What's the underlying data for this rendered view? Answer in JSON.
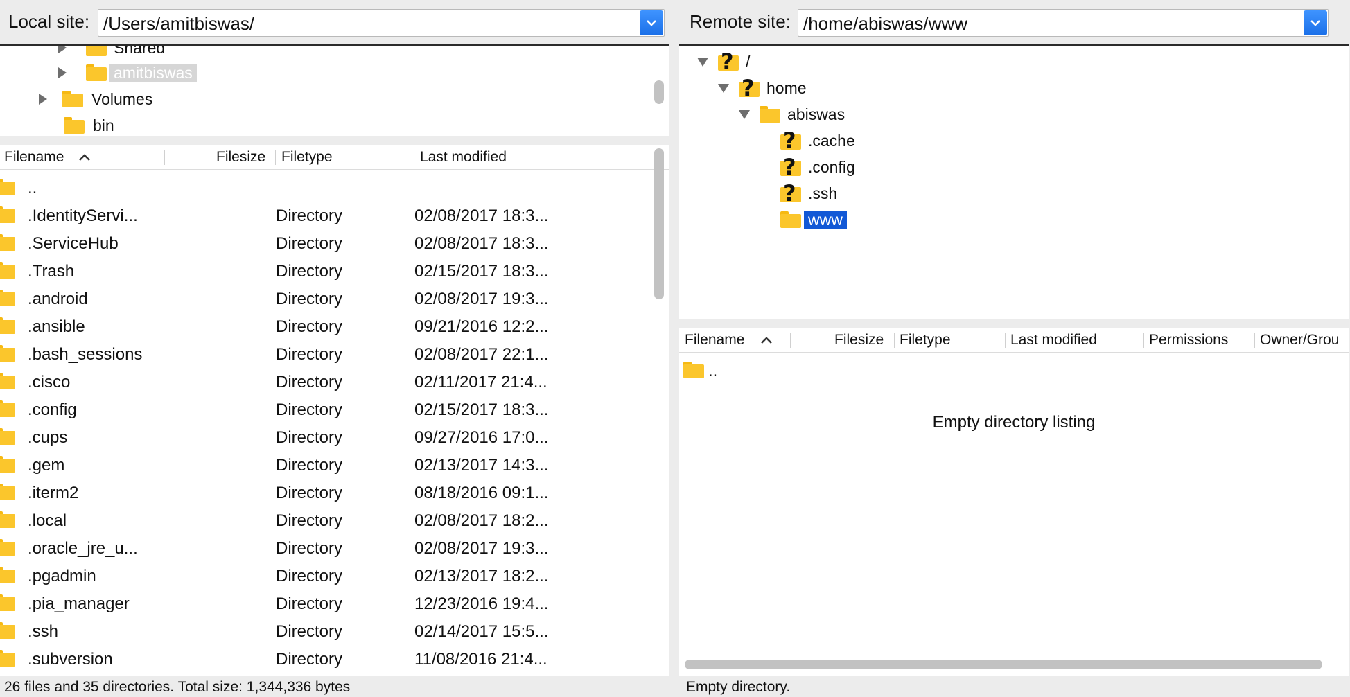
{
  "local": {
    "label": "Local site:",
    "path": "/Users/amitbiswas/",
    "tree": [
      {
        "label": "Shared",
        "expander": "right"
      },
      {
        "label": "amitbiswas",
        "expander": "right",
        "selected": true
      },
      {
        "label": "Volumes",
        "expander": "right"
      },
      {
        "label": "bin",
        "expander": ""
      }
    ],
    "columns": {
      "filename": "Filename",
      "filesize": "Filesize",
      "filetype": "Filetype",
      "modified": "Last modified"
    },
    "files": [
      {
        "name": "..",
        "type": "",
        "modified": ""
      },
      {
        "name": ".IdentityServi...",
        "type": "Directory",
        "modified": "02/08/2017 18:3..."
      },
      {
        "name": ".ServiceHub",
        "type": "Directory",
        "modified": "02/08/2017 18:3..."
      },
      {
        "name": ".Trash",
        "type": "Directory",
        "modified": "02/15/2017 18:3..."
      },
      {
        "name": ".android",
        "type": "Directory",
        "modified": "02/08/2017 19:3..."
      },
      {
        "name": ".ansible",
        "type": "Directory",
        "modified": "09/21/2016 12:2..."
      },
      {
        "name": ".bash_sessions",
        "type": "Directory",
        "modified": "02/08/2017 22:1..."
      },
      {
        "name": ".cisco",
        "type": "Directory",
        "modified": "02/11/2017 21:4..."
      },
      {
        "name": ".config",
        "type": "Directory",
        "modified": "02/15/2017 18:3..."
      },
      {
        "name": ".cups",
        "type": "Directory",
        "modified": "09/27/2016 17:0..."
      },
      {
        "name": ".gem",
        "type": "Directory",
        "modified": "02/13/2017 14:3..."
      },
      {
        "name": ".iterm2",
        "type": "Directory",
        "modified": "08/18/2016 09:1..."
      },
      {
        "name": ".local",
        "type": "Directory",
        "modified": "02/08/2017 18:2..."
      },
      {
        "name": ".oracle_jre_u...",
        "type": "Directory",
        "modified": "02/08/2017 19:3..."
      },
      {
        "name": ".pgadmin",
        "type": "Directory",
        "modified": "02/13/2017 18:2..."
      },
      {
        "name": ".pia_manager",
        "type": "Directory",
        "modified": "12/23/2016 19:4..."
      },
      {
        "name": ".ssh",
        "type": "Directory",
        "modified": "02/14/2017 15:5..."
      },
      {
        "name": ".subversion",
        "type": "Directory",
        "modified": "11/08/2016 21:4..."
      }
    ],
    "status": "26 files and 35 directories. Total size: 1,344,336 bytes"
  },
  "remote": {
    "label": "Remote site:",
    "path": "/home/abiswas/www",
    "tree": [
      {
        "label": "/",
        "expander": "down",
        "icon": "question-folder-icon",
        "depth": 0
      },
      {
        "label": "home",
        "expander": "down",
        "icon": "question-folder-icon",
        "depth": 1
      },
      {
        "label": "abiswas",
        "expander": "down",
        "icon": "folder-icon",
        "depth": 2
      },
      {
        "label": ".cache",
        "expander": "",
        "icon": "question-folder-icon",
        "depth": 3
      },
      {
        "label": ".config",
        "expander": "",
        "icon": "question-folder-icon",
        "depth": 3
      },
      {
        "label": ".ssh",
        "expander": "",
        "icon": "question-folder-icon",
        "depth": 3
      },
      {
        "label": "www",
        "expander": "",
        "icon": "open-folder-icon",
        "depth": 3,
        "selected": true
      }
    ],
    "columns": {
      "filename": "Filename",
      "filesize": "Filesize",
      "filetype": "Filetype",
      "modified": "Last modified",
      "permissions": "Permissions",
      "owner": "Owner/Grou"
    },
    "parent_entry": "..",
    "empty_message": "Empty directory listing",
    "status": "Empty directory."
  }
}
